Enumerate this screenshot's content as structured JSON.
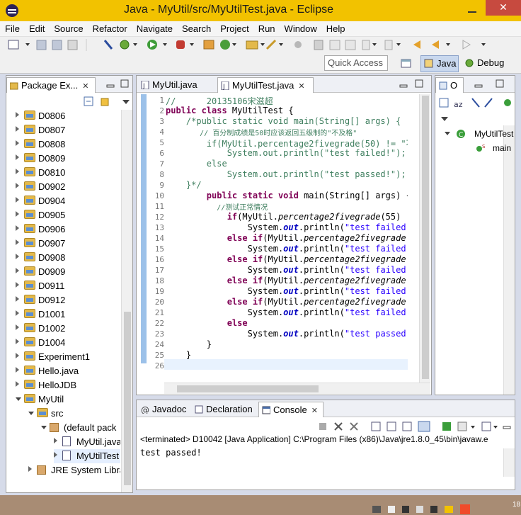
{
  "window": {
    "title": "Java - MyUtil/src/MyUtilTest.java - Eclipse",
    "close_label": "✕"
  },
  "menu": [
    "File",
    "Edit",
    "Source",
    "Refactor",
    "Navigate",
    "Search",
    "Project",
    "Run",
    "Window",
    "Help"
  ],
  "toolbar": {
    "quick_access": "Quick Access",
    "java_label": "Java",
    "debug_label": "Debug"
  },
  "package_explorer": {
    "tab_label": "Package Ex...",
    "items": [
      {
        "label": "D0806",
        "depth": 0,
        "kind": "project",
        "open": false
      },
      {
        "label": "D0807",
        "depth": 0,
        "kind": "project",
        "open": false
      },
      {
        "label": "D0808",
        "depth": 0,
        "kind": "project",
        "open": false
      },
      {
        "label": "D0809",
        "depth": 0,
        "kind": "project",
        "open": false
      },
      {
        "label": "D0810",
        "depth": 0,
        "kind": "project",
        "open": false
      },
      {
        "label": "D0902",
        "depth": 0,
        "kind": "project",
        "open": false
      },
      {
        "label": "D0904",
        "depth": 0,
        "kind": "project",
        "open": false
      },
      {
        "label": "D0905",
        "depth": 0,
        "kind": "project",
        "open": false
      },
      {
        "label": "D0906",
        "depth": 0,
        "kind": "project",
        "open": false
      },
      {
        "label": "D0907",
        "depth": 0,
        "kind": "project",
        "open": false
      },
      {
        "label": "D0908",
        "depth": 0,
        "kind": "project",
        "open": false
      },
      {
        "label": "D0909",
        "depth": 0,
        "kind": "project",
        "open": false
      },
      {
        "label": "D0911",
        "depth": 0,
        "kind": "project",
        "open": false
      },
      {
        "label": "D0912",
        "depth": 0,
        "kind": "project",
        "open": false
      },
      {
        "label": "D1001",
        "depth": 0,
        "kind": "project",
        "open": false
      },
      {
        "label": "D1002",
        "depth": 0,
        "kind": "project",
        "open": false
      },
      {
        "label": "D1004",
        "depth": 0,
        "kind": "project",
        "open": false
      },
      {
        "label": "Experiment1",
        "depth": 0,
        "kind": "project",
        "open": false
      },
      {
        "label": "Hello.java",
        "depth": 0,
        "kind": "project",
        "open": false
      },
      {
        "label": "HelloJDB",
        "depth": 0,
        "kind": "project",
        "open": false
      },
      {
        "label": "MyUtil",
        "depth": 0,
        "kind": "project",
        "open": true
      },
      {
        "label": "src",
        "depth": 1,
        "kind": "src",
        "open": true
      },
      {
        "label": "(default pack",
        "depth": 2,
        "kind": "package",
        "open": true
      },
      {
        "label": "MyUtil.java",
        "depth": 3,
        "kind": "java",
        "open": false
      },
      {
        "label": "MyUtilTest",
        "depth": 3,
        "kind": "java",
        "open": false,
        "selected": true
      },
      {
        "label": "JRE System Libra",
        "depth": 1,
        "kind": "lib",
        "open": false
      }
    ]
  },
  "editor": {
    "tabs": [
      {
        "label": "MyUtil.java",
        "active": false
      },
      {
        "label": "MyUtilTest.java",
        "active": true
      }
    ],
    "line_numbers": [
      "1",
      "2",
      "3",
      "4",
      "5",
      "6",
      "7",
      "8",
      "9",
      "10",
      "11",
      "12",
      "13",
      "14",
      "15",
      "16",
      "17",
      "18",
      "19",
      "20",
      "21",
      "22",
      "23",
      "24",
      "25",
      "26"
    ]
  },
  "outline": {
    "tab_label": "O",
    "class_name": "MyUtilTest",
    "method_name": "main"
  },
  "bottom": {
    "tabs": [
      "Javadoc",
      "Declaration",
      "Console"
    ],
    "terminated": "<terminated> D10042 [Java Application] C:\\Program Files (x86)\\Java\\jre1.8.0_45\\bin\\javaw.e",
    "output": "test passed!"
  },
  "taskbar": {
    "clock": "18"
  }
}
